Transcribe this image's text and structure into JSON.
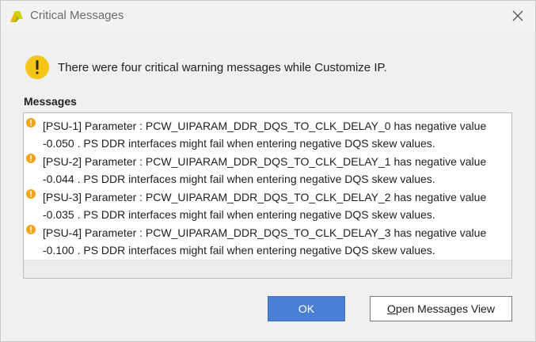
{
  "window": {
    "title": "Critical Messages",
    "close_icon": "close-icon",
    "app_icon": "vivado-logo-icon"
  },
  "summary": {
    "icon": "warning-icon",
    "text": "There were four critical warning messages while Customize IP."
  },
  "messages": {
    "label": "Messages",
    "items": [
      {
        "id": "[PSU-1]",
        "line1": "[PSU-1]  Parameter : PCW_UIPARAM_DDR_DQS_TO_CLK_DELAY_0 has negative value",
        "line2": "-0.050 . PS DDR interfaces might fail when entering negative DQS skew values."
      },
      {
        "id": "[PSU-2]",
        "line1": "[PSU-2]  Parameter : PCW_UIPARAM_DDR_DQS_TO_CLK_DELAY_1 has negative value",
        "line2": "-0.044 . PS DDR interfaces might fail when entering negative DQS skew values."
      },
      {
        "id": "[PSU-3]",
        "line1": "[PSU-3]  Parameter : PCW_UIPARAM_DDR_DQS_TO_CLK_DELAY_2 has negative value",
        "line2": "-0.035 . PS DDR interfaces might fail when entering negative DQS skew values."
      },
      {
        "id": "[PSU-4]",
        "line1": "[PSU-4]  Parameter : PCW_UIPARAM_DDR_DQS_TO_CLK_DELAY_3 has negative value",
        "line2": "-0.100 . PS DDR interfaces might fail when entering negative DQS skew values."
      }
    ]
  },
  "buttons": {
    "ok": "OK",
    "open_messages_first": "O",
    "open_messages_rest": "pen Messages View"
  },
  "colors": {
    "accent": "#4a7fd4",
    "warning": "#f2a51a",
    "summary_warning": "#f5c518"
  }
}
